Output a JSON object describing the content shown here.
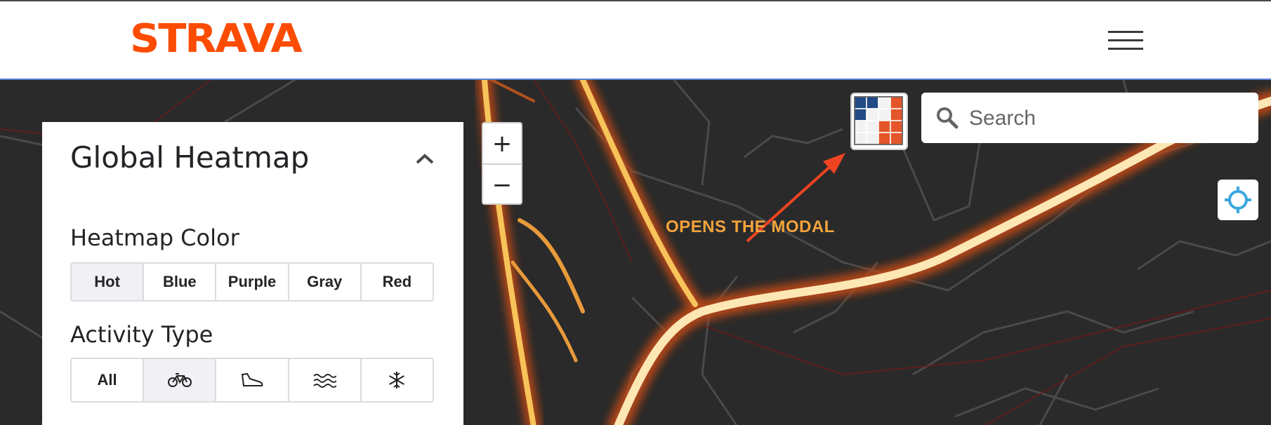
{
  "header": {
    "logo_text": "STRAVA",
    "menu_icon": "hamburger-icon",
    "brand_color": "#fc4c02"
  },
  "panel": {
    "title": "Global Heatmap",
    "collapse_icon": "chevron-up-icon",
    "heatmap_color": {
      "label": "Heatmap Color",
      "options": [
        "Hot",
        "Blue",
        "Purple",
        "Gray",
        "Red"
      ],
      "selected": "Hot"
    },
    "activity_type": {
      "label": "Activity Type",
      "all_label": "All",
      "options": [
        "All",
        "bike-icon",
        "shoe-icon",
        "water-icon",
        "snowflake-icon"
      ],
      "selected": "bike-icon"
    }
  },
  "map": {
    "zoom_in": "+",
    "zoom_out": "−",
    "style_button_icon": "map-style-grid-icon",
    "search_placeholder": "Search",
    "search_icon": "search-icon",
    "locate_icon": "locate-crosshair-icon",
    "annotation_text": "OPENS THE MODAL",
    "annotation_color": "#f3a33c",
    "arrow_color": "#ee4422"
  }
}
